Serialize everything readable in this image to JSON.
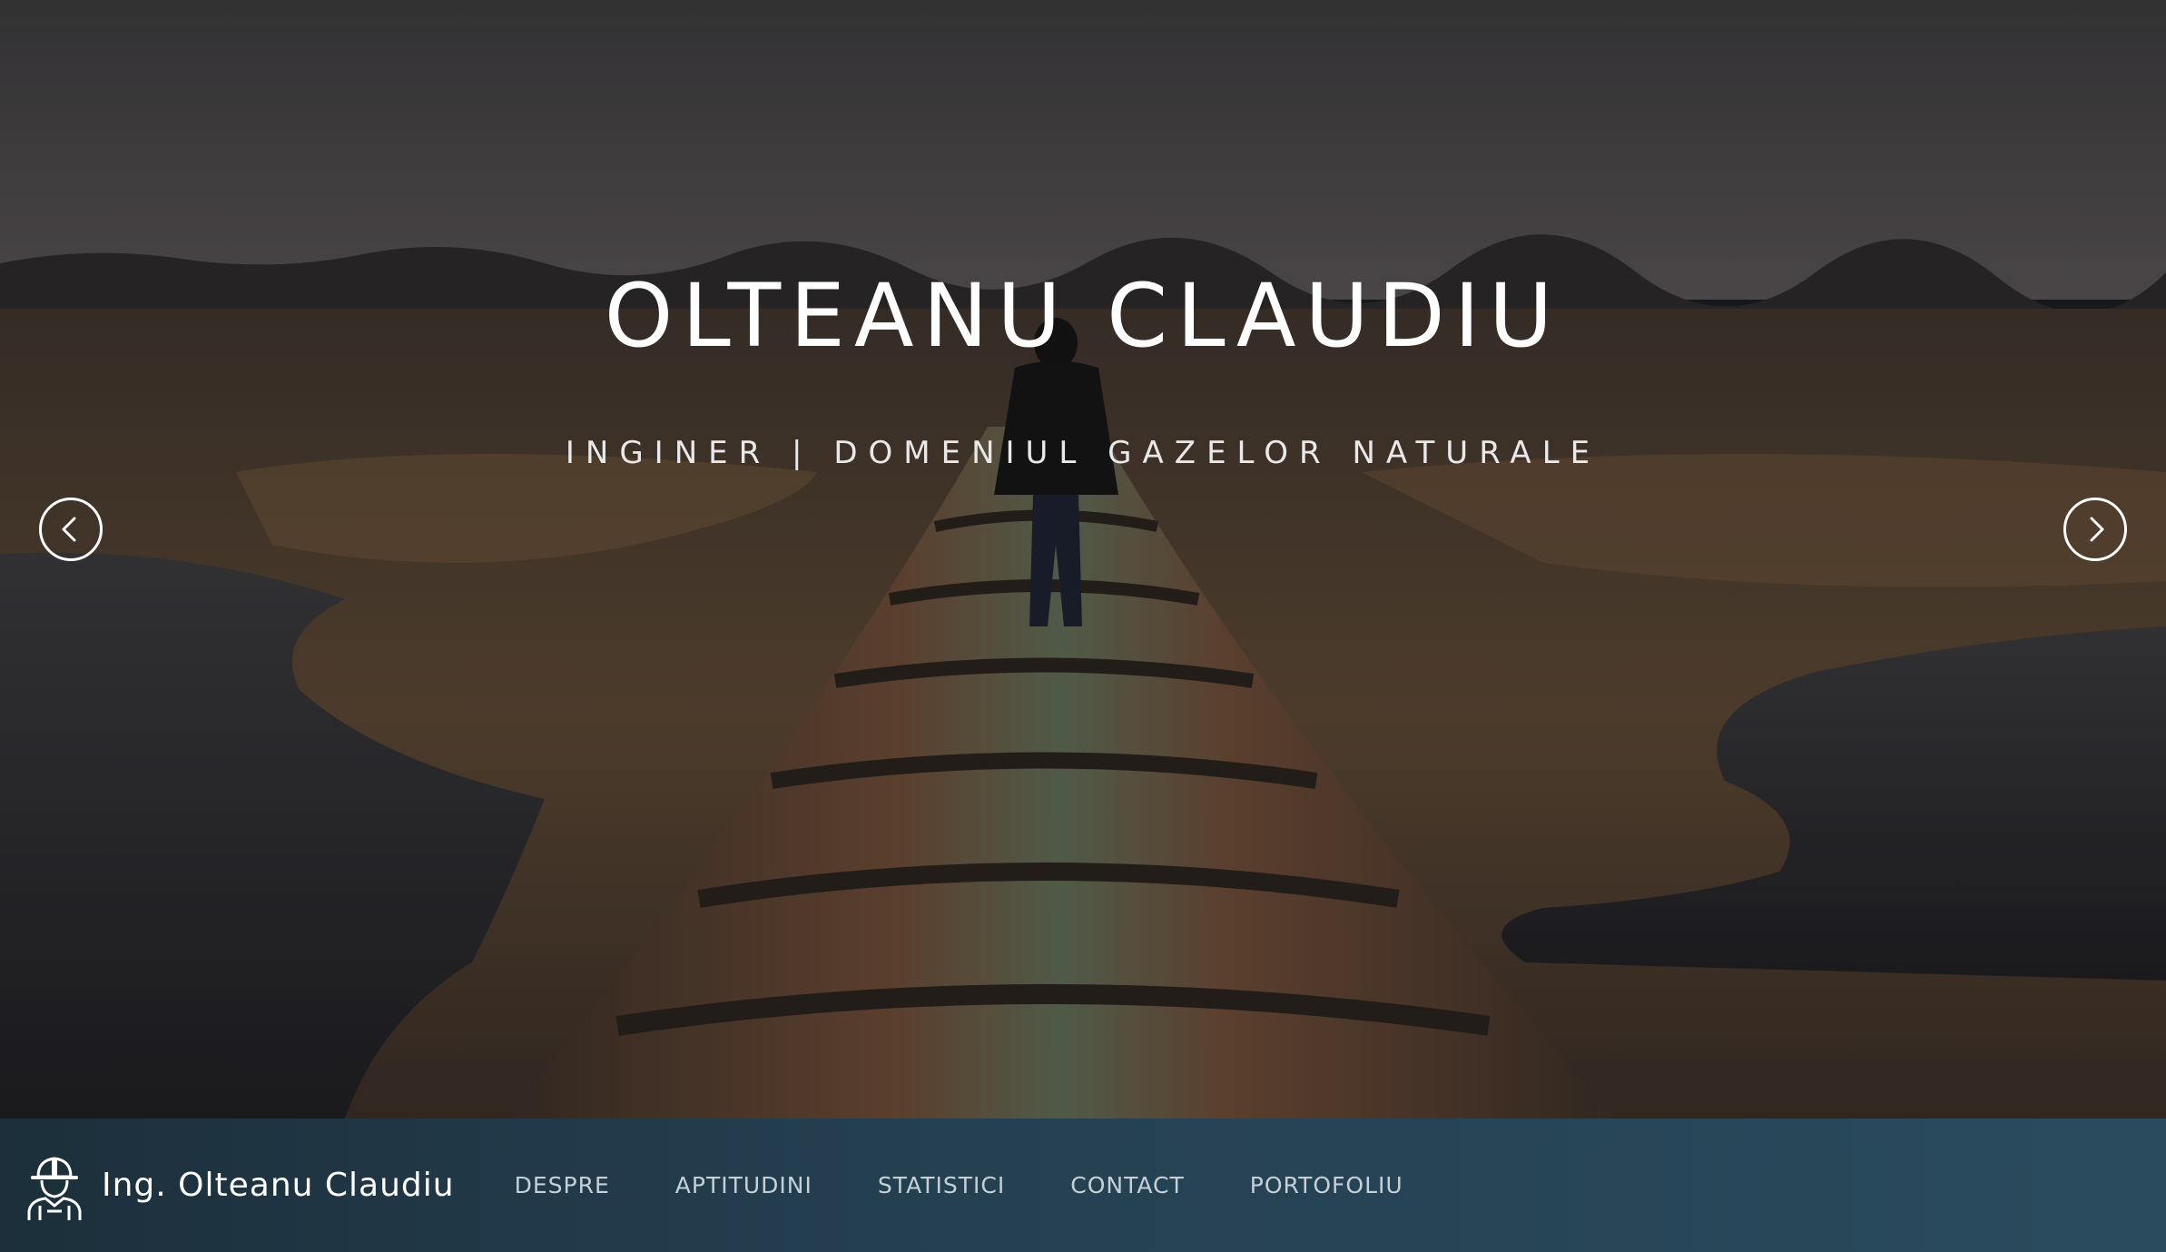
{
  "hero": {
    "title": "OLTEANU CLAUDIU",
    "subtitle": "INGINER | DOMENIUL GAZELOR NATURALE",
    "prev_icon": "chevron-left-icon",
    "next_icon": "chevron-right-icon"
  },
  "navbar": {
    "brand_icon": "engineer-helmet-icon",
    "brand_name": "Ing. Olteanu Claudiu",
    "links": [
      {
        "label": "DESPRE"
      },
      {
        "label": "APTITUDINI"
      },
      {
        "label": "STATISTICI"
      },
      {
        "label": "CONTACT"
      },
      {
        "label": "PORTOFOLIU"
      }
    ]
  },
  "colors": {
    "navbar_bg": "#243f50",
    "nav_text": "#c5d0d7",
    "hero_text": "#ffffff"
  }
}
